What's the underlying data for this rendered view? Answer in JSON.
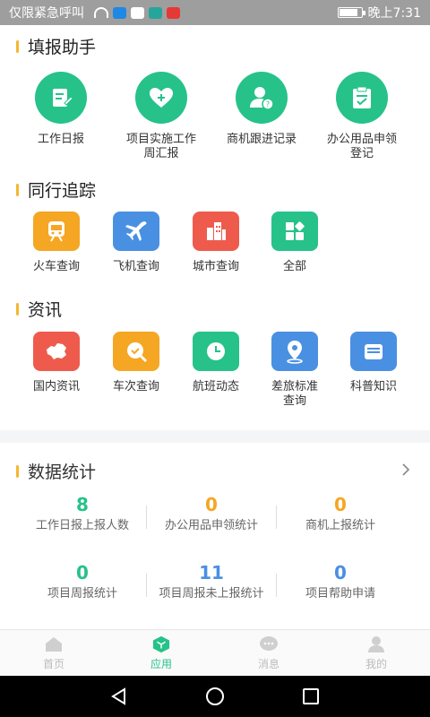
{
  "status_bar": {
    "carrier": "仅限紧急呼叫",
    "time": "晚上7:31"
  },
  "sections": {
    "fill": {
      "title": "填报助手",
      "items": [
        {
          "label": "工作日报",
          "icon": "daily-report-icon"
        },
        {
          "label": "项目实施工作周汇报",
          "icon": "weekly-report-icon"
        },
        {
          "label": "商机跟进记录",
          "icon": "business-lead-icon"
        },
        {
          "label": "办公用品申领登记",
          "icon": "office-supplies-icon"
        }
      ]
    },
    "tracking": {
      "title": "同行追踪",
      "items": [
        {
          "label": "火车查询",
          "icon": "train-icon",
          "color": "#f5a623"
        },
        {
          "label": "飞机查询",
          "icon": "plane-icon",
          "color": "#4a90e2"
        },
        {
          "label": "城市查询",
          "icon": "city-icon",
          "color": "#ee5b4d"
        },
        {
          "label": "全部",
          "icon": "all-icon",
          "color": "#26c28a"
        }
      ]
    },
    "news": {
      "title": "资讯",
      "items": [
        {
          "label": "国内资讯",
          "icon": "china-map-icon",
          "color": "#ee5b4d"
        },
        {
          "label": "车次查询",
          "icon": "search-icon",
          "color": "#f5a623"
        },
        {
          "label": "航班动态",
          "icon": "clock-icon",
          "color": "#26c28a"
        },
        {
          "label": "差旅标准查询",
          "icon": "location-pin-icon",
          "color": "#4a90e2"
        },
        {
          "label": "科普知识",
          "icon": "folder-icon",
          "color": "#4a90e2"
        }
      ]
    }
  },
  "stats": {
    "title": "数据统计",
    "rows": [
      [
        {
          "value": "8",
          "caption": "工作日报上报人数",
          "color": "#26c28a"
        },
        {
          "value": "0",
          "caption": "办公用品申领统计",
          "color": "#f5a623"
        },
        {
          "value": "0",
          "caption": "商机上报统计",
          "color": "#f5a623"
        }
      ],
      [
        {
          "value": "0",
          "caption": "项目周报统计",
          "color": "#26c28a"
        },
        {
          "value": "11",
          "caption": "项目周报未上报统计",
          "color": "#4a90e2"
        },
        {
          "value": "0",
          "caption": "项目帮助申请",
          "color": "#4a90e2"
        }
      ]
    ]
  },
  "tabbar": {
    "tabs": [
      {
        "label": "首页",
        "icon": "home-icon",
        "active": false
      },
      {
        "label": "应用",
        "icon": "apps-icon",
        "active": true
      },
      {
        "label": "消息",
        "icon": "message-icon",
        "active": false
      },
      {
        "label": "我的",
        "icon": "profile-icon",
        "active": false
      }
    ]
  },
  "colors": {
    "accent": "#26c28a",
    "section_bar": "#f5b731"
  }
}
